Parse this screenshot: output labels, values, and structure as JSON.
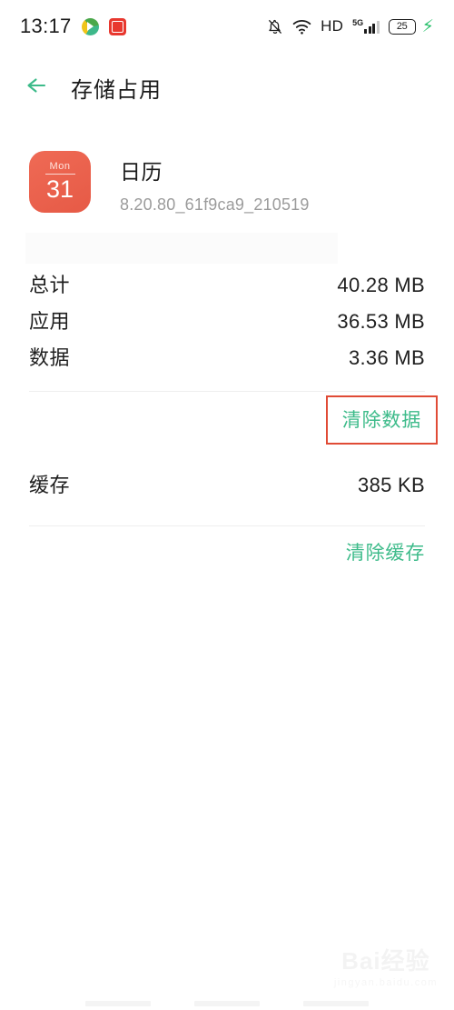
{
  "statusbar": {
    "time": "13:17",
    "notification_icons": [
      "media-play-icon",
      "red-app-icon"
    ],
    "hd_label": "HD",
    "network_label": "5G",
    "battery_level": "25",
    "charging": true,
    "icons": [
      "bell-off-icon",
      "wifi-icon",
      "hd-icon",
      "signal-5g-icon",
      "battery-icon",
      "charging-bolt-icon"
    ]
  },
  "header": {
    "back_icon": "arrow-left-icon",
    "title": "存储占用"
  },
  "app": {
    "icon_label_weekday": "Mon",
    "icon_label_day": "31",
    "name": "日历",
    "version": "8.20.80_61f9ca9_210519"
  },
  "storage": {
    "rows": [
      {
        "label": "总计",
        "value": "40.28 MB"
      },
      {
        "label": "应用",
        "value": "36.53 MB"
      },
      {
        "label": "数据",
        "value": "3.36 MB"
      }
    ],
    "cache_row": {
      "label": "缓存",
      "value": "385 KB"
    }
  },
  "actions": {
    "clear_data": "清除数据",
    "clear_cache": "清除缓存"
  },
  "annotation": {
    "target": "清除数据",
    "box_color": "#e04b36"
  },
  "colors": {
    "accent_green": "#3dbb8a",
    "app_icon_red": "#e8614d",
    "text_primary": "#1f1f1f",
    "text_secondary": "#9b9b9b",
    "divider": "#efefef",
    "annotation_red": "#e04b36"
  },
  "watermark": {
    "main": "Bai经验",
    "sub": "jingyan.baidu.com"
  }
}
